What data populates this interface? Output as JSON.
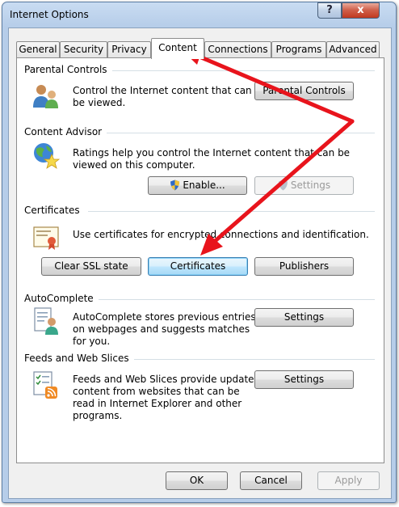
{
  "window": {
    "title": "Internet Options",
    "help_label": "?",
    "close_label": "x"
  },
  "tabs": [
    {
      "label": "General"
    },
    {
      "label": "Security"
    },
    {
      "label": "Privacy"
    },
    {
      "label": "Content"
    },
    {
      "label": "Connections"
    },
    {
      "label": "Programs"
    },
    {
      "label": "Advanced"
    }
  ],
  "active_tab": "Content",
  "parental_controls": {
    "title": "Parental Controls",
    "desc_line1": "Control the Internet content that can",
    "desc_line2": "be viewed.",
    "button_label": "Parental Controls"
  },
  "content_advisor": {
    "title": "Content Advisor",
    "desc_line1": "Ratings help you control the Internet content that can be",
    "desc_line2": "viewed on this computer.",
    "enable_label": "Enable...",
    "settings_label": "Settings"
  },
  "certificates": {
    "title": "Certificates",
    "desc": "Use certificates for encrypted connections and identification.",
    "clear_ssl_label": "Clear SSL state",
    "certificates_label": "Certificates",
    "publishers_label": "Publishers"
  },
  "autocomplete": {
    "title": "AutoComplete",
    "desc_line1": "AutoComplete stores previous entries",
    "desc_line2": "on webpages and suggests matches",
    "desc_line3": "for you.",
    "settings_label": "Settings"
  },
  "feeds": {
    "title": "Feeds and Web Slices",
    "desc_line1": "Feeds and Web Slices provide updated",
    "desc_line2": "content from websites that can be",
    "desc_line3": "read in Internet Explorer and other",
    "desc_line4": "programs.",
    "settings_label": "Settings"
  },
  "footer": {
    "ok_label": "OK",
    "cancel_label": "Cancel",
    "apply_label": "Apply"
  },
  "colors": {
    "annotation_arrow": "#e8141c",
    "focus_border": "#3c7fb1"
  }
}
